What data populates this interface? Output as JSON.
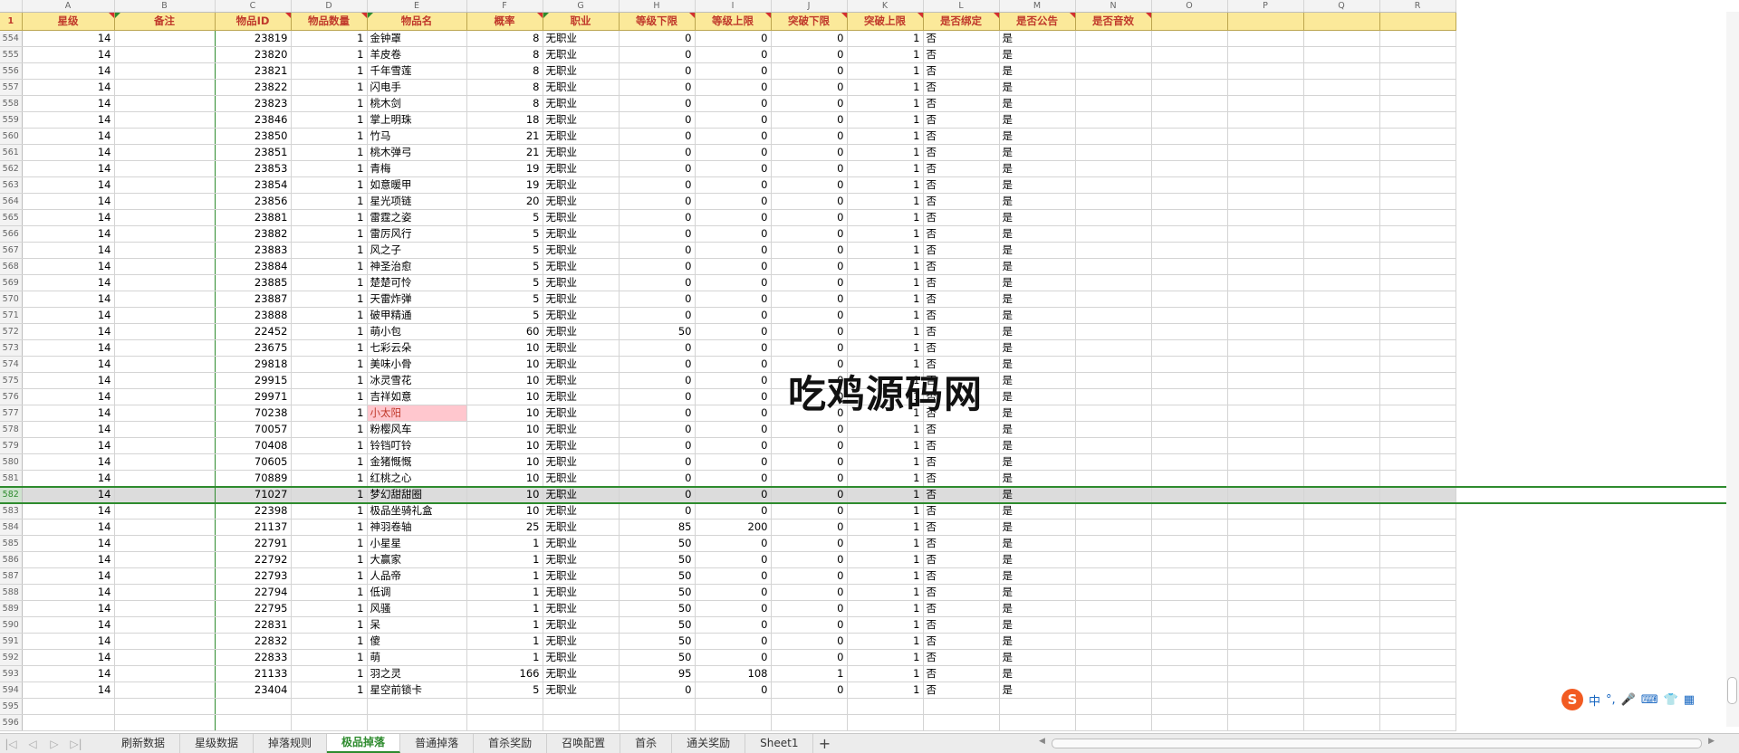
{
  "columns": [
    "A",
    "B",
    "C",
    "D",
    "E",
    "F",
    "G",
    "H",
    "I",
    "J",
    "K",
    "L",
    "M",
    "N",
    "O",
    "P",
    "Q",
    "R"
  ],
  "header_row_number": "1",
  "headers": [
    "星级",
    "备注",
    "物品ID",
    "物品数量",
    "物品名",
    "概率",
    "职业",
    "等级下限",
    "等级上限",
    "突破下限",
    "突破上限",
    "是否绑定",
    "是否公告",
    "是否音效",
    "",
    "",
    "",
    ""
  ],
  "rows": [
    {
      "n": "554",
      "a": "14",
      "c": "23819",
      "d": "1",
      "e": "金钟罩",
      "f": "8",
      "g": "无职业",
      "h": "0",
      "i": "0",
      "j": "0",
      "k": "1",
      "l": "否",
      "m": "是"
    },
    {
      "n": "555",
      "a": "14",
      "c": "23820",
      "d": "1",
      "e": "羊皮卷",
      "f": "8",
      "g": "无职业",
      "h": "0",
      "i": "0",
      "j": "0",
      "k": "1",
      "l": "否",
      "m": "是"
    },
    {
      "n": "556",
      "a": "14",
      "c": "23821",
      "d": "1",
      "e": "千年雪莲",
      "f": "8",
      "g": "无职业",
      "h": "0",
      "i": "0",
      "j": "0",
      "k": "1",
      "l": "否",
      "m": "是"
    },
    {
      "n": "557",
      "a": "14",
      "c": "23822",
      "d": "1",
      "e": "闪电手",
      "f": "8",
      "g": "无职业",
      "h": "0",
      "i": "0",
      "j": "0",
      "k": "1",
      "l": "否",
      "m": "是"
    },
    {
      "n": "558",
      "a": "14",
      "c": "23823",
      "d": "1",
      "e": "桃木剑",
      "f": "8",
      "g": "无职业",
      "h": "0",
      "i": "0",
      "j": "0",
      "k": "1",
      "l": "否",
      "m": "是"
    },
    {
      "n": "559",
      "a": "14",
      "c": "23846",
      "d": "1",
      "e": "掌上明珠",
      "f": "18",
      "g": "无职业",
      "h": "0",
      "i": "0",
      "j": "0",
      "k": "1",
      "l": "否",
      "m": "是"
    },
    {
      "n": "560",
      "a": "14",
      "c": "23850",
      "d": "1",
      "e": "竹马",
      "f": "21",
      "g": "无职业",
      "h": "0",
      "i": "0",
      "j": "0",
      "k": "1",
      "l": "否",
      "m": "是"
    },
    {
      "n": "561",
      "a": "14",
      "c": "23851",
      "d": "1",
      "e": "桃木弹弓",
      "f": "21",
      "g": "无职业",
      "h": "0",
      "i": "0",
      "j": "0",
      "k": "1",
      "l": "否",
      "m": "是"
    },
    {
      "n": "562",
      "a": "14",
      "c": "23853",
      "d": "1",
      "e": "青梅",
      "f": "19",
      "g": "无职业",
      "h": "0",
      "i": "0",
      "j": "0",
      "k": "1",
      "l": "否",
      "m": "是"
    },
    {
      "n": "563",
      "a": "14",
      "c": "23854",
      "d": "1",
      "e": "如意暖甲",
      "f": "19",
      "g": "无职业",
      "h": "0",
      "i": "0",
      "j": "0",
      "k": "1",
      "l": "否",
      "m": "是"
    },
    {
      "n": "564",
      "a": "14",
      "c": "23856",
      "d": "1",
      "e": "星光项链",
      "f": "20",
      "g": "无职业",
      "h": "0",
      "i": "0",
      "j": "0",
      "k": "1",
      "l": "否",
      "m": "是"
    },
    {
      "n": "565",
      "a": "14",
      "c": "23881",
      "d": "1",
      "e": "雷霆之姿",
      "f": "5",
      "g": "无职业",
      "h": "0",
      "i": "0",
      "j": "0",
      "k": "1",
      "l": "否",
      "m": "是"
    },
    {
      "n": "566",
      "a": "14",
      "c": "23882",
      "d": "1",
      "e": "雷厉风行",
      "f": "5",
      "g": "无职业",
      "h": "0",
      "i": "0",
      "j": "0",
      "k": "1",
      "l": "否",
      "m": "是"
    },
    {
      "n": "567",
      "a": "14",
      "c": "23883",
      "d": "1",
      "e": "风之子",
      "f": "5",
      "g": "无职业",
      "h": "0",
      "i": "0",
      "j": "0",
      "k": "1",
      "l": "否",
      "m": "是"
    },
    {
      "n": "568",
      "a": "14",
      "c": "23884",
      "d": "1",
      "e": "神圣治愈",
      "f": "5",
      "g": "无职业",
      "h": "0",
      "i": "0",
      "j": "0",
      "k": "1",
      "l": "否",
      "m": "是"
    },
    {
      "n": "569",
      "a": "14",
      "c": "23885",
      "d": "1",
      "e": "楚楚可怜",
      "f": "5",
      "g": "无职业",
      "h": "0",
      "i": "0",
      "j": "0",
      "k": "1",
      "l": "否",
      "m": "是"
    },
    {
      "n": "570",
      "a": "14",
      "c": "23887",
      "d": "1",
      "e": "天雷炸弹",
      "f": "5",
      "g": "无职业",
      "h": "0",
      "i": "0",
      "j": "0",
      "k": "1",
      "l": "否",
      "m": "是"
    },
    {
      "n": "571",
      "a": "14",
      "c": "23888",
      "d": "1",
      "e": "破甲精通",
      "f": "5",
      "g": "无职业",
      "h": "0",
      "i": "0",
      "j": "0",
      "k": "1",
      "l": "否",
      "m": "是"
    },
    {
      "n": "572",
      "a": "14",
      "c": "22452",
      "d": "1",
      "e": "萌小包",
      "f": "60",
      "g": "无职业",
      "h": "50",
      "i": "0",
      "j": "0",
      "k": "1",
      "l": "否",
      "m": "是"
    },
    {
      "n": "573",
      "a": "14",
      "c": "23675",
      "d": "1",
      "e": "七彩云朵",
      "f": "10",
      "g": "无职业",
      "h": "0",
      "i": "0",
      "j": "0",
      "k": "1",
      "l": "否",
      "m": "是"
    },
    {
      "n": "574",
      "a": "14",
      "c": "29818",
      "d": "1",
      "e": "美味小骨",
      "f": "10",
      "g": "无职业",
      "h": "0",
      "i": "0",
      "j": "0",
      "k": "1",
      "l": "否",
      "m": "是"
    },
    {
      "n": "575",
      "a": "14",
      "c": "29915",
      "d": "1",
      "e": "冰灵雪花",
      "f": "10",
      "g": "无职业",
      "h": "0",
      "i": "0",
      "j": "0",
      "k": "1",
      "l": "否",
      "m": "是"
    },
    {
      "n": "576",
      "a": "14",
      "c": "29971",
      "d": "1",
      "e": "吉祥如意",
      "f": "10",
      "g": "无职业",
      "h": "0",
      "i": "0",
      "j": "0",
      "k": "1",
      "l": "否",
      "m": "是"
    },
    {
      "n": "577",
      "a": "14",
      "c": "70238",
      "d": "1",
      "e": "小太阳",
      "f": "10",
      "g": "无职业",
      "h": "0",
      "i": "0",
      "j": "0",
      "k": "1",
      "l": "否",
      "m": "是",
      "hi": true
    },
    {
      "n": "578",
      "a": "14",
      "c": "70057",
      "d": "1",
      "e": "粉樱风车",
      "f": "10",
      "g": "无职业",
      "h": "0",
      "i": "0",
      "j": "0",
      "k": "1",
      "l": "否",
      "m": "是"
    },
    {
      "n": "579",
      "a": "14",
      "c": "70408",
      "d": "1",
      "e": "铃铛叮铃",
      "f": "10",
      "g": "无职业",
      "h": "0",
      "i": "0",
      "j": "0",
      "k": "1",
      "l": "否",
      "m": "是"
    },
    {
      "n": "580",
      "a": "14",
      "c": "70605",
      "d": "1",
      "e": "金猪慨慨",
      "f": "10",
      "g": "无职业",
      "h": "0",
      "i": "0",
      "j": "0",
      "k": "1",
      "l": "否",
      "m": "是"
    },
    {
      "n": "581",
      "a": "14",
      "c": "70889",
      "d": "1",
      "e": "红桃之心",
      "f": "10",
      "g": "无职业",
      "h": "0",
      "i": "0",
      "j": "0",
      "k": "1",
      "l": "否",
      "m": "是"
    },
    {
      "n": "582",
      "a": "14",
      "c": "71027",
      "d": "1",
      "e": "梦幻甜甜圈",
      "f": "10",
      "g": "无职业",
      "h": "0",
      "i": "0",
      "j": "0",
      "k": "1",
      "l": "否",
      "m": "是",
      "sel": true
    },
    {
      "n": "583",
      "a": "14",
      "c": "22398",
      "d": "1",
      "e": "极品坐骑礼盒",
      "f": "10",
      "g": "无职业",
      "h": "0",
      "i": "0",
      "j": "0",
      "k": "1",
      "l": "否",
      "m": "是"
    },
    {
      "n": "584",
      "a": "14",
      "c": "21137",
      "d": "1",
      "e": "神羽卷轴",
      "f": "25",
      "g": "无职业",
      "h": "85",
      "i": "200",
      "j": "0",
      "k": "1",
      "l": "否",
      "m": "是"
    },
    {
      "n": "585",
      "a": "14",
      "c": "22791",
      "d": "1",
      "e": "小星星",
      "f": "1",
      "g": "无职业",
      "h": "50",
      "i": "0",
      "j": "0",
      "k": "1",
      "l": "否",
      "m": "是"
    },
    {
      "n": "586",
      "a": "14",
      "c": "22792",
      "d": "1",
      "e": "大赢家",
      "f": "1",
      "g": "无职业",
      "h": "50",
      "i": "0",
      "j": "0",
      "k": "1",
      "l": "否",
      "m": "是"
    },
    {
      "n": "587",
      "a": "14",
      "c": "22793",
      "d": "1",
      "e": "人品帝",
      "f": "1",
      "g": "无职业",
      "h": "50",
      "i": "0",
      "j": "0",
      "k": "1",
      "l": "否",
      "m": "是"
    },
    {
      "n": "588",
      "a": "14",
      "c": "22794",
      "d": "1",
      "e": "低调",
      "f": "1",
      "g": "无职业",
      "h": "50",
      "i": "0",
      "j": "0",
      "k": "1",
      "l": "否",
      "m": "是"
    },
    {
      "n": "589",
      "a": "14",
      "c": "22795",
      "d": "1",
      "e": "风骚",
      "f": "1",
      "g": "无职业",
      "h": "50",
      "i": "0",
      "j": "0",
      "k": "1",
      "l": "否",
      "m": "是"
    },
    {
      "n": "590",
      "a": "14",
      "c": "22831",
      "d": "1",
      "e": "呆",
      "f": "1",
      "g": "无职业",
      "h": "50",
      "i": "0",
      "j": "0",
      "k": "1",
      "l": "否",
      "m": "是"
    },
    {
      "n": "591",
      "a": "14",
      "c": "22832",
      "d": "1",
      "e": "傻",
      "f": "1",
      "g": "无职业",
      "h": "50",
      "i": "0",
      "j": "0",
      "k": "1",
      "l": "否",
      "m": "是"
    },
    {
      "n": "592",
      "a": "14",
      "c": "22833",
      "d": "1",
      "e": "萌",
      "f": "1",
      "g": "无职业",
      "h": "50",
      "i": "0",
      "j": "0",
      "k": "1",
      "l": "否",
      "m": "是"
    },
    {
      "n": "593",
      "a": "14",
      "c": "21133",
      "d": "1",
      "e": "羽之灵",
      "f": "166",
      "g": "无职业",
      "h": "95",
      "i": "108",
      "j": "1",
      "k": "1",
      "l": "否",
      "m": "是"
    },
    {
      "n": "594",
      "a": "14",
      "c": "23404",
      "d": "1",
      "e": "星空前锁卡",
      "f": "5",
      "g": "无职业",
      "h": "0",
      "i": "0",
      "j": "0",
      "k": "1",
      "l": "否",
      "m": "是"
    },
    {
      "n": "595"
    },
    {
      "n": "596"
    }
  ],
  "watermark": "吃鸡源码网",
  "sheet_tabs": [
    {
      "label": "刷新数据",
      "active": false
    },
    {
      "label": "星级数据",
      "active": false
    },
    {
      "label": "掉落规则",
      "active": false
    },
    {
      "label": "极品掉落",
      "active": true
    },
    {
      "label": "普通掉落",
      "active": false
    },
    {
      "label": "首杀奖励",
      "active": false
    },
    {
      "label": "召唤配置",
      "active": false
    },
    {
      "label": "首杀",
      "active": false
    },
    {
      "label": "通关奖励",
      "active": false
    },
    {
      "label": "Sheet1",
      "active": false
    }
  ],
  "add_sheet_icon": "plus-icon",
  "ime": {
    "logo": "S",
    "lang": "中",
    "punct": "°,",
    "mic_icon": "mic-icon",
    "keyboard_icon": "keyboard-icon",
    "skin_icon": "shirt-icon",
    "toolbox_icon": "grid-icon"
  },
  "colors": {
    "header_bg": "#fbe99a",
    "header_text": "#c0392b",
    "accent": "#2e8b2e",
    "highlight_bg": "#ffc7ce"
  }
}
